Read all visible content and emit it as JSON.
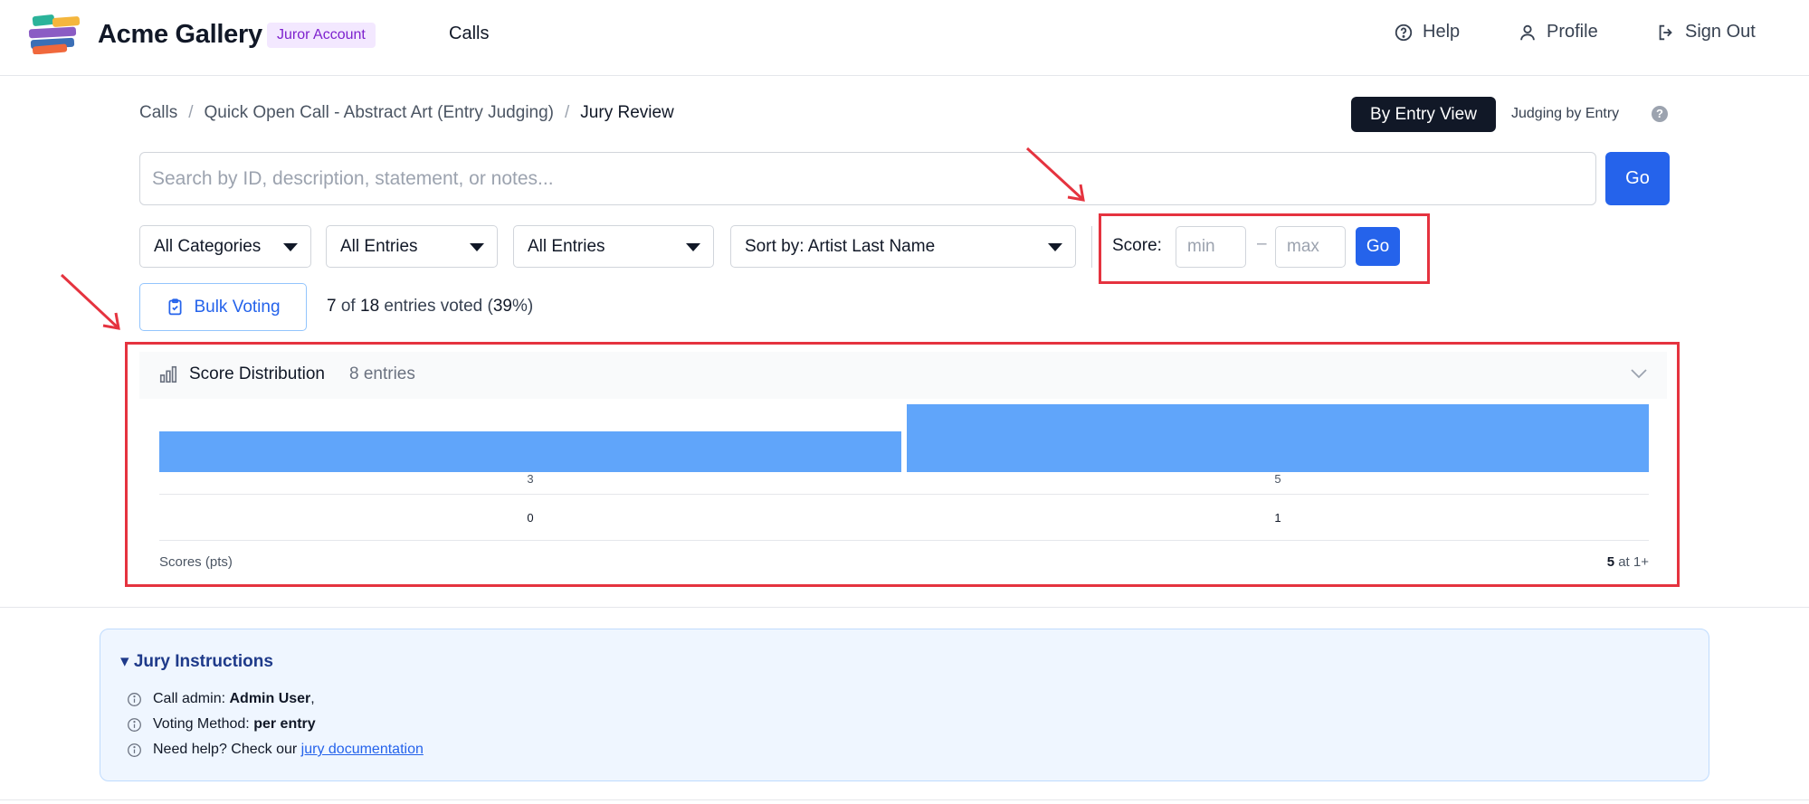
{
  "header": {
    "brand": "Acme Gallery",
    "account_badge": "Juror Account",
    "nav_calls": "Calls",
    "help": "Help",
    "profile": "Profile",
    "sign_out": "Sign Out"
  },
  "breadcrumb": {
    "items": [
      "Calls",
      "Quick Open Call - Abstract Art (Entry Judging)",
      "Jury Review"
    ],
    "separator": "/"
  },
  "view": {
    "button": "By Entry View",
    "judging": "Judging by Entry",
    "help_mark": "?"
  },
  "search": {
    "placeholder": "Search by ID, description, statement, or notes...",
    "go": "Go"
  },
  "filters": {
    "category": "All Categories",
    "entries_1": "All Entries",
    "entries_2": "All Entries",
    "sort": "Sort by: Artist Last Name"
  },
  "score_filter": {
    "label": "Score:",
    "min_placeholder": "min",
    "max_placeholder": "max",
    "dash": "–",
    "go": "Go"
  },
  "voting": {
    "bulk_button": "Bulk Voting",
    "voted": "7",
    "of": "of",
    "total": "18",
    "suffix": "entries voted (",
    "percent": "39",
    "percent_suffix": "%)"
  },
  "distribution": {
    "title": "Score Distribution",
    "count": "8 entries",
    "footer_left": "Scores (pts)",
    "footer_count": "5",
    "footer_suffix": "at 1+"
  },
  "chart_data": {
    "type": "bar",
    "categories": [
      "3",
      "5"
    ],
    "values": [
      0,
      1
    ],
    "bar_heights_relative": [
      0.6,
      1.0
    ],
    "title": "Score Distribution",
    "xlabel": "Scores (pts)",
    "ylabel": "",
    "colors": [
      "#60a5fa"
    ]
  },
  "instructions": {
    "title": "▾ Jury Instructions",
    "admin_label": "Call admin:",
    "admin_value": "Admin User",
    "admin_tail": ",",
    "method_label": "Voting Method:",
    "method_value": "per entry",
    "help_text": "Need help? Check our",
    "help_link": "jury documentation"
  },
  "colors": {
    "primary": "#2563eb",
    "highlight": "#e5333f",
    "bar": "#60a5fa",
    "badge_bg": "#f3e8ff",
    "badge_text": "#7e22ce"
  }
}
